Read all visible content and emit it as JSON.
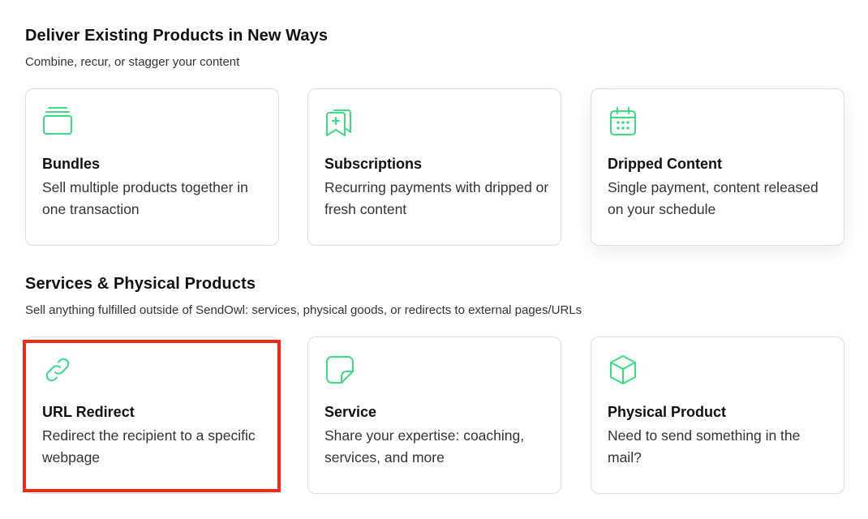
{
  "sections": [
    {
      "title": "Deliver Existing Products in New Ways",
      "subtitle": "Combine, recur, or stagger your content",
      "cards": [
        {
          "icon": "bundle-icon",
          "title": "Bundles",
          "description": "Sell multiple products together in one transaction"
        },
        {
          "icon": "subscription-icon",
          "title": "Subscriptions",
          "description": "Recurring payments with dripped or fresh content"
        },
        {
          "icon": "calendar-icon",
          "title": "Dripped Content",
          "description": "Single payment, content released on your schedule"
        }
      ]
    },
    {
      "title": "Services & Physical Products",
      "subtitle": "Sell anything fulfilled outside of SendOwl: services, physical goods, or redirects to external pages/URLs",
      "cards": [
        {
          "icon": "link-icon",
          "title": "URL Redirect",
          "description": "Redirect the recipient to a specific webpage"
        },
        {
          "icon": "note-icon",
          "title": "Service",
          "description": "Share your expertise: coaching, services, and more"
        },
        {
          "icon": "cube-icon",
          "title": "Physical Product",
          "description": "Need to send something in the mail?"
        }
      ]
    }
  ],
  "colors": {
    "accent": "#3ddc84",
    "highlight": "#f02a14",
    "card_border": "#dedede"
  }
}
